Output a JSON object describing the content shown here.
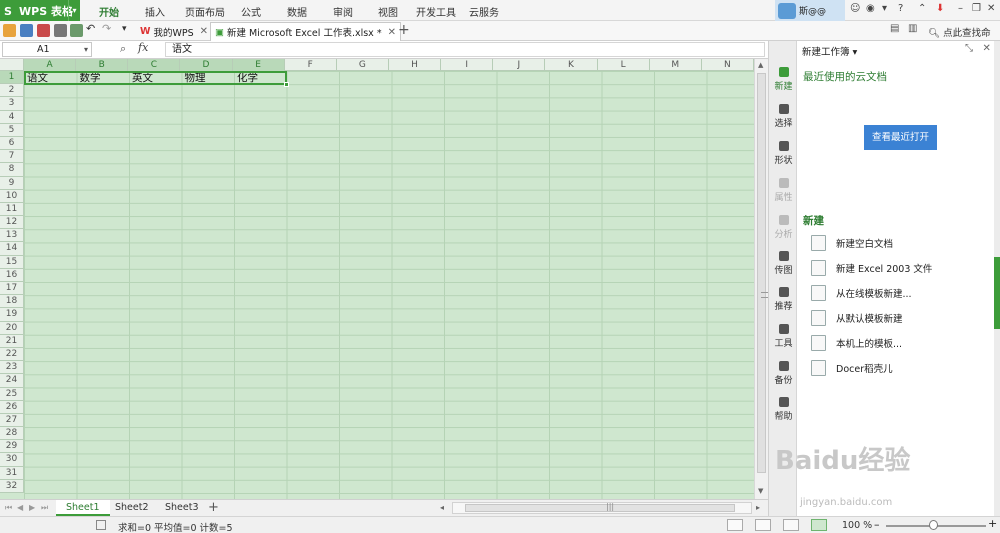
{
  "app": {
    "name": "WPS 表格",
    "logo": "S"
  },
  "menu": [
    "开始",
    "插入",
    "页面布局",
    "公式",
    "数据",
    "审阅",
    "视图",
    "开发工具",
    "云服务"
  ],
  "menu_active": "开始",
  "user": {
    "name": "斯@@"
  },
  "tabs": [
    {
      "label": "我的WPS",
      "active": false
    },
    {
      "label": "新建 Microsoft Excel 工作表.xlsx *",
      "active": true
    }
  ],
  "find_command": "点此查找命令",
  "namebox": "A1",
  "formula": "语文",
  "columns": [
    "A",
    "B",
    "C",
    "D",
    "E",
    "F",
    "G",
    "H",
    "I",
    "J",
    "K",
    "L",
    "M",
    "N"
  ],
  "rows": [
    1,
    2,
    3,
    4,
    5,
    6,
    7,
    8,
    9,
    10,
    11,
    12,
    13,
    14,
    15,
    16,
    17,
    18,
    19,
    20,
    21,
    22,
    23,
    24,
    25,
    26,
    27,
    28,
    29,
    30,
    31,
    32
  ],
  "row1_cells": [
    "语文",
    "数学",
    "英文",
    "物理",
    "化学"
  ],
  "sheets": [
    "Sheet1",
    "Sheet2",
    "Sheet3"
  ],
  "active_sheet": "Sheet1",
  "status": "求和=0  平均值=0  计数=5",
  "zoom": "100 %",
  "side_rail": [
    {
      "label": "新建",
      "state": "active"
    },
    {
      "label": "选择",
      "state": "normal"
    },
    {
      "label": "形状",
      "state": "normal"
    },
    {
      "label": "属性",
      "state": "disabled"
    },
    {
      "label": "分析",
      "state": "disabled"
    },
    {
      "label": "传图",
      "state": "normal"
    },
    {
      "label": "推荐",
      "state": "normal"
    },
    {
      "label": "工具",
      "state": "normal"
    },
    {
      "label": "备份",
      "state": "normal"
    },
    {
      "label": "帮助",
      "state": "normal"
    }
  ],
  "task_pane": {
    "title": "新建工作簿",
    "recent_heading": "最近使用的云文档",
    "recent_button": "查看最近打开",
    "new_heading": "新建",
    "new_items": [
      "新建空白文档",
      "新建 Excel 2003 文件",
      "从在线模板新建...",
      "从默认模板新建",
      "本机上的模板...",
      "Docer稻壳儿"
    ]
  },
  "watermark": {
    "text": "Baidu经验",
    "sub": "jingyan.baidu.com"
  },
  "colors": {
    "accent": "#3d9c3a",
    "grid_bg": "#cfe7cf",
    "button_blue": "#3b82d4"
  }
}
